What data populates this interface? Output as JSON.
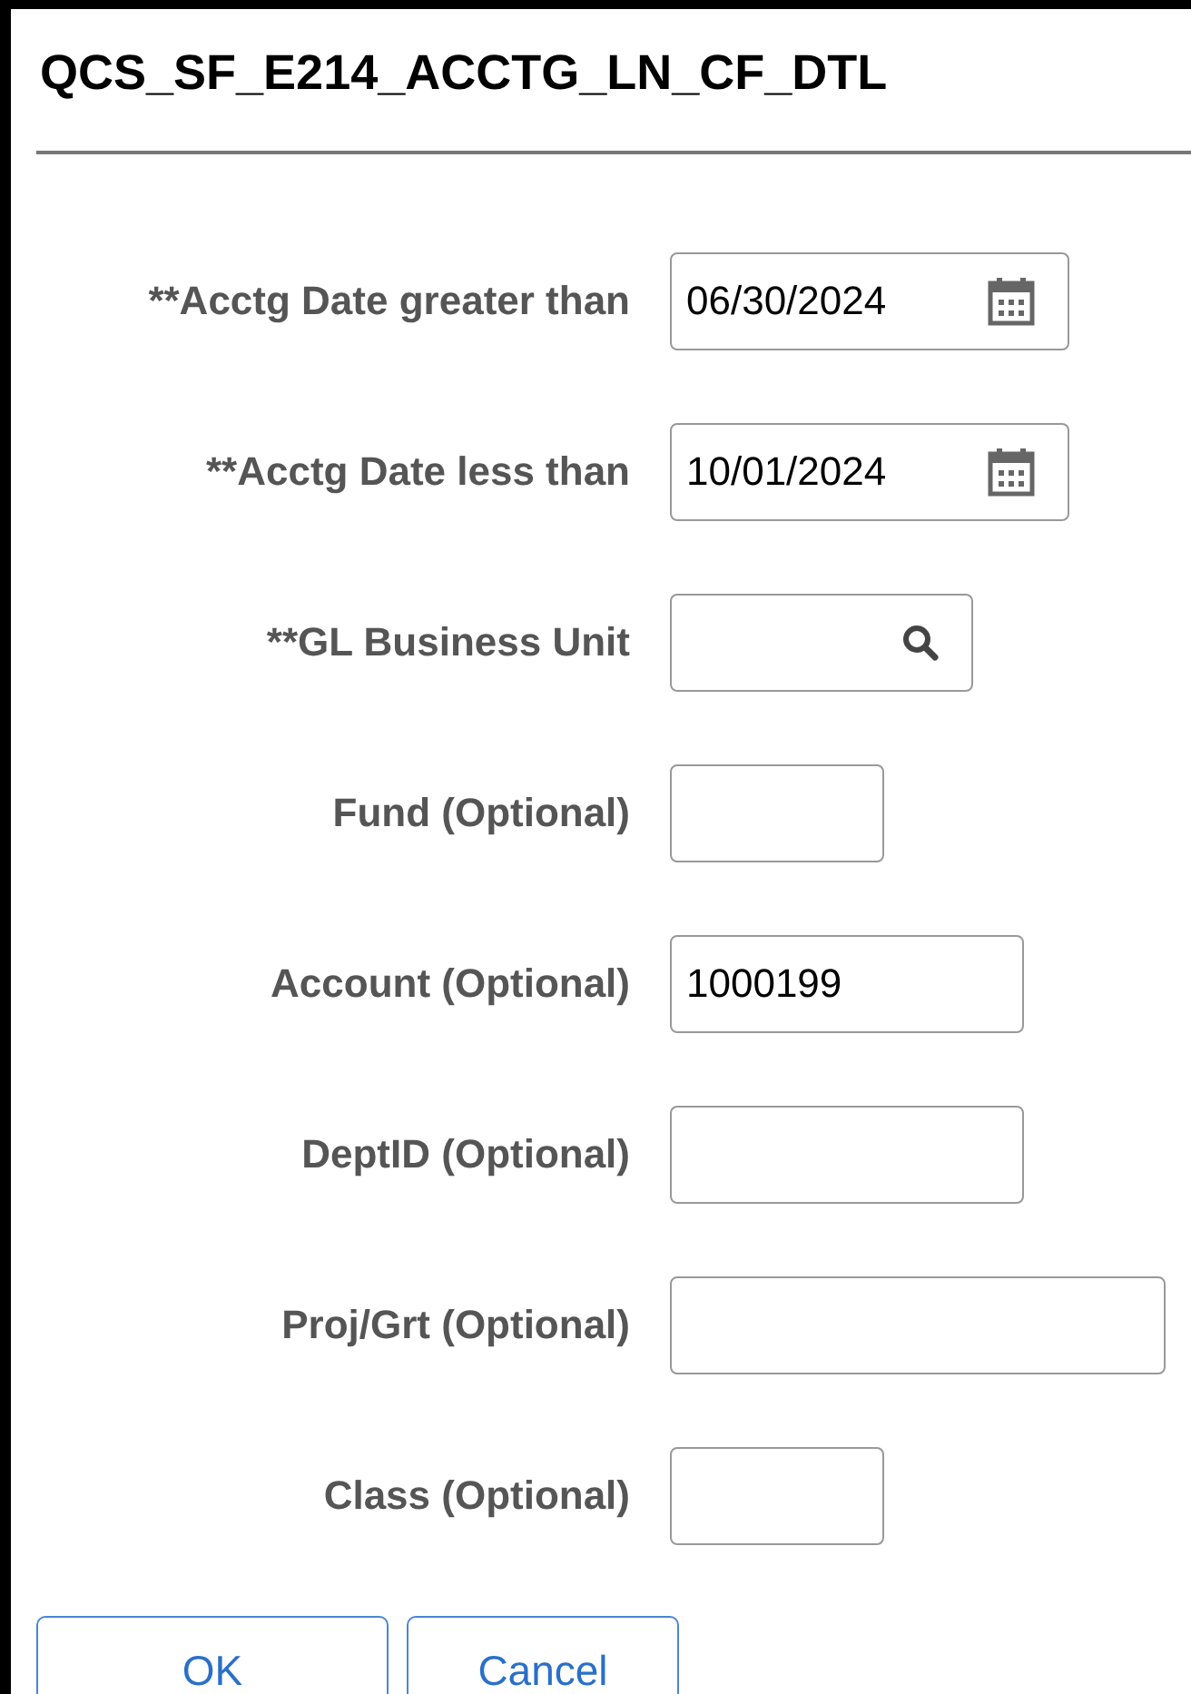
{
  "title": "QCS_SF_E214_ACCTG_LN_CF_DTL",
  "fields": [
    {
      "label": "**Acctg Date greater than",
      "kind": "date",
      "value": "06/30/2024"
    },
    {
      "label": "**Acctg Date less than",
      "kind": "date",
      "value": "10/01/2024"
    },
    {
      "label": "**GL Business Unit",
      "kind": "lookup"
    },
    {
      "label": "Fund (Optional)",
      "kind": "text"
    },
    {
      "label": "Account (Optional)",
      "kind": "text",
      "value": "1000199"
    },
    {
      "label": "DeptID (Optional)",
      "kind": "text"
    },
    {
      "label": "Proj/Grt (Optional)",
      "kind": "text"
    },
    {
      "label": "Class (Optional)",
      "kind": "text"
    }
  ],
  "buttons": [
    "OK",
    "Cancel"
  ]
}
